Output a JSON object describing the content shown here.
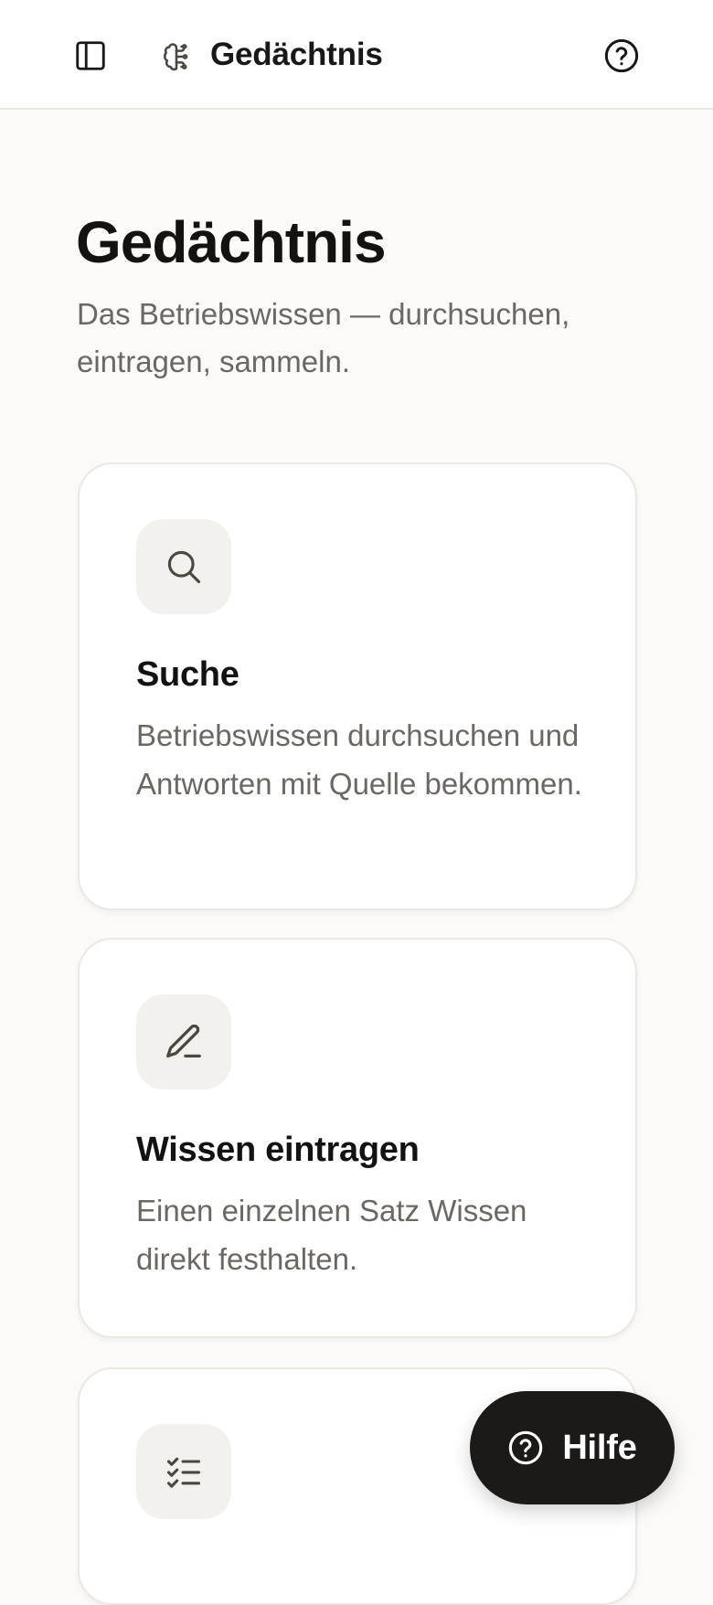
{
  "header": {
    "title": "Gedächtnis",
    "icons": {
      "sidebar_toggle": "sidebar-panel-icon",
      "brand": "brain-icon",
      "help": "help-circle-icon"
    }
  },
  "page": {
    "title": "Gedächtnis",
    "subtitle": "Das Betriebswissen — durchsuchen, eintragen, sammeln."
  },
  "cards": [
    {
      "icon": "search-icon",
      "title": "Suche",
      "description": "Betriebswissen durchsuchen und Antworten mit Quelle bekommen."
    },
    {
      "icon": "pencil-icon",
      "title": "Wissen eintragen",
      "description": "Einen einzelnen Satz Wissen direkt festhalten."
    },
    {
      "icon": "checklist-icon",
      "title": "",
      "description": ""
    }
  ],
  "help_button": {
    "label": "Hilfe",
    "icon": "help-circle-icon"
  },
  "colors": {
    "background": "#fbfaf8",
    "surface": "#ffffff",
    "border": "#ebe8e3",
    "icon_tile": "#f3f1ed",
    "text_primary": "#141210",
    "text_secondary": "#6b6763",
    "fab_background": "#1c1a18"
  }
}
